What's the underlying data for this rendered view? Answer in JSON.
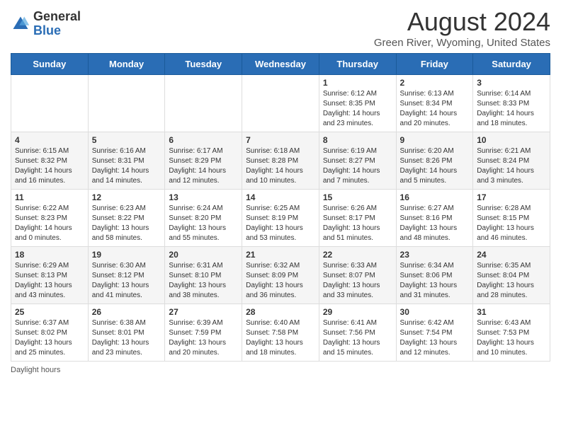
{
  "logo": {
    "general": "General",
    "blue": "Blue"
  },
  "header": {
    "title": "August 2024",
    "subtitle": "Green River, Wyoming, United States"
  },
  "days_of_week": [
    "Sunday",
    "Monday",
    "Tuesday",
    "Wednesday",
    "Thursday",
    "Friday",
    "Saturday"
  ],
  "weeks": [
    [
      {
        "day": "",
        "info": ""
      },
      {
        "day": "",
        "info": ""
      },
      {
        "day": "",
        "info": ""
      },
      {
        "day": "",
        "info": ""
      },
      {
        "day": "1",
        "info": "Sunrise: 6:12 AM\nSunset: 8:35 PM\nDaylight: 14 hours and 23 minutes."
      },
      {
        "day": "2",
        "info": "Sunrise: 6:13 AM\nSunset: 8:34 PM\nDaylight: 14 hours and 20 minutes."
      },
      {
        "day": "3",
        "info": "Sunrise: 6:14 AM\nSunset: 8:33 PM\nDaylight: 14 hours and 18 minutes."
      }
    ],
    [
      {
        "day": "4",
        "info": "Sunrise: 6:15 AM\nSunset: 8:32 PM\nDaylight: 14 hours and 16 minutes."
      },
      {
        "day": "5",
        "info": "Sunrise: 6:16 AM\nSunset: 8:31 PM\nDaylight: 14 hours and 14 minutes."
      },
      {
        "day": "6",
        "info": "Sunrise: 6:17 AM\nSunset: 8:29 PM\nDaylight: 14 hours and 12 minutes."
      },
      {
        "day": "7",
        "info": "Sunrise: 6:18 AM\nSunset: 8:28 PM\nDaylight: 14 hours and 10 minutes."
      },
      {
        "day": "8",
        "info": "Sunrise: 6:19 AM\nSunset: 8:27 PM\nDaylight: 14 hours and 7 minutes."
      },
      {
        "day": "9",
        "info": "Sunrise: 6:20 AM\nSunset: 8:26 PM\nDaylight: 14 hours and 5 minutes."
      },
      {
        "day": "10",
        "info": "Sunrise: 6:21 AM\nSunset: 8:24 PM\nDaylight: 14 hours and 3 minutes."
      }
    ],
    [
      {
        "day": "11",
        "info": "Sunrise: 6:22 AM\nSunset: 8:23 PM\nDaylight: 14 hours and 0 minutes."
      },
      {
        "day": "12",
        "info": "Sunrise: 6:23 AM\nSunset: 8:22 PM\nDaylight: 13 hours and 58 minutes."
      },
      {
        "day": "13",
        "info": "Sunrise: 6:24 AM\nSunset: 8:20 PM\nDaylight: 13 hours and 55 minutes."
      },
      {
        "day": "14",
        "info": "Sunrise: 6:25 AM\nSunset: 8:19 PM\nDaylight: 13 hours and 53 minutes."
      },
      {
        "day": "15",
        "info": "Sunrise: 6:26 AM\nSunset: 8:17 PM\nDaylight: 13 hours and 51 minutes."
      },
      {
        "day": "16",
        "info": "Sunrise: 6:27 AM\nSunset: 8:16 PM\nDaylight: 13 hours and 48 minutes."
      },
      {
        "day": "17",
        "info": "Sunrise: 6:28 AM\nSunset: 8:15 PM\nDaylight: 13 hours and 46 minutes."
      }
    ],
    [
      {
        "day": "18",
        "info": "Sunrise: 6:29 AM\nSunset: 8:13 PM\nDaylight: 13 hours and 43 minutes."
      },
      {
        "day": "19",
        "info": "Sunrise: 6:30 AM\nSunset: 8:12 PM\nDaylight: 13 hours and 41 minutes."
      },
      {
        "day": "20",
        "info": "Sunrise: 6:31 AM\nSunset: 8:10 PM\nDaylight: 13 hours and 38 minutes."
      },
      {
        "day": "21",
        "info": "Sunrise: 6:32 AM\nSunset: 8:09 PM\nDaylight: 13 hours and 36 minutes."
      },
      {
        "day": "22",
        "info": "Sunrise: 6:33 AM\nSunset: 8:07 PM\nDaylight: 13 hours and 33 minutes."
      },
      {
        "day": "23",
        "info": "Sunrise: 6:34 AM\nSunset: 8:06 PM\nDaylight: 13 hours and 31 minutes."
      },
      {
        "day": "24",
        "info": "Sunrise: 6:35 AM\nSunset: 8:04 PM\nDaylight: 13 hours and 28 minutes."
      }
    ],
    [
      {
        "day": "25",
        "info": "Sunrise: 6:37 AM\nSunset: 8:02 PM\nDaylight: 13 hours and 25 minutes."
      },
      {
        "day": "26",
        "info": "Sunrise: 6:38 AM\nSunset: 8:01 PM\nDaylight: 13 hours and 23 minutes."
      },
      {
        "day": "27",
        "info": "Sunrise: 6:39 AM\nSunset: 7:59 PM\nDaylight: 13 hours and 20 minutes."
      },
      {
        "day": "28",
        "info": "Sunrise: 6:40 AM\nSunset: 7:58 PM\nDaylight: 13 hours and 18 minutes."
      },
      {
        "day": "29",
        "info": "Sunrise: 6:41 AM\nSunset: 7:56 PM\nDaylight: 13 hours and 15 minutes."
      },
      {
        "day": "30",
        "info": "Sunrise: 6:42 AM\nSunset: 7:54 PM\nDaylight: 13 hours and 12 minutes."
      },
      {
        "day": "31",
        "info": "Sunrise: 6:43 AM\nSunset: 7:53 PM\nDaylight: 13 hours and 10 minutes."
      }
    ]
  ],
  "footer": {
    "note": "Daylight hours"
  }
}
